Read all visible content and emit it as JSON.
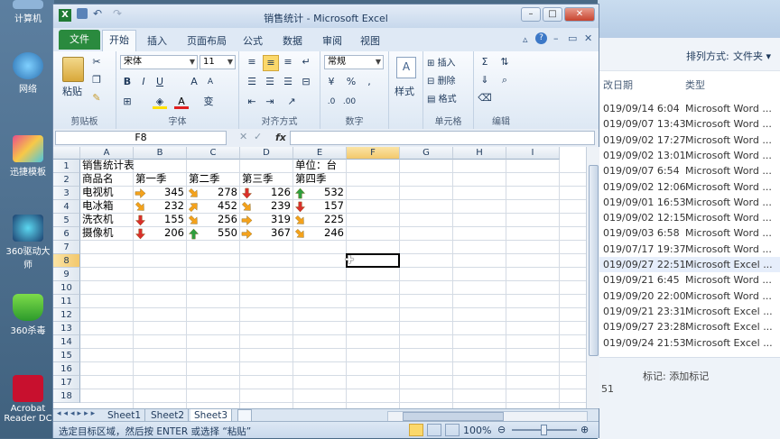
{
  "desktop": {
    "icons": [
      {
        "label": "计算机"
      },
      {
        "label": "网络"
      },
      {
        "label": "迅捷模板"
      },
      {
        "label": "360驱动大师"
      },
      {
        "label": "360杀毒"
      },
      {
        "label": "Acrobat Reader DC"
      }
    ]
  },
  "explorer": {
    "sort_label": "排列方式:",
    "sort_value": "文件夹 ▾",
    "col_date": "改日期",
    "col_type": "类型",
    "rows": [
      {
        "date": "019/09/14 6:04",
        "type": "Microsoft Word ..."
      },
      {
        "date": "019/09/07 13:43",
        "type": "Microsoft Word ..."
      },
      {
        "date": "019/09/02 17:27",
        "type": "Microsoft Word ..."
      },
      {
        "date": "019/09/02 13:01",
        "type": "Microsoft Word ..."
      },
      {
        "date": "019/09/07 6:54",
        "type": "Microsoft Word ..."
      },
      {
        "date": "019/09/02 12:06",
        "type": "Microsoft Word ..."
      },
      {
        "date": "019/09/01 16:53",
        "type": "Microsoft Word ..."
      },
      {
        "date": "019/09/02 12:15",
        "type": "Microsoft Word ..."
      },
      {
        "date": "019/09/03 6:58",
        "type": "Microsoft Word ..."
      },
      {
        "date": "019/07/17 19:37",
        "type": "Microsoft Word ..."
      },
      {
        "date": "019/09/27 22:51",
        "type": "Microsoft Excel ..."
      },
      {
        "date": "019/09/21 6:45",
        "type": "Microsoft Word ..."
      },
      {
        "date": "019/09/20 22:00",
        "type": "Microsoft Word ..."
      },
      {
        "date": "019/09/21 23:31",
        "type": "Microsoft Excel ..."
      },
      {
        "date": "019/09/27 23:28",
        "type": "Microsoft Excel ..."
      },
      {
        "date": "019/09/24 21:53",
        "type": "Microsoft Excel ..."
      }
    ],
    "tag_label": "标记: 添加标记",
    "count": "51"
  },
  "excel": {
    "title": "销售统计 - Microsoft Excel",
    "tabs": [
      "文件",
      "开始",
      "插入",
      "页面布局",
      "公式",
      "数据",
      "审阅",
      "视图"
    ],
    "groups": {
      "clipboard": "剪贴板",
      "font": "字体",
      "alignment": "对齐方式",
      "number": "数字",
      "cells": "单元格",
      "editing": "编辑"
    },
    "paste_label": "粘贴",
    "font_name": "宋体",
    "font_size": "11",
    "number_format": "常规",
    "style_label": "样式",
    "insert_label": "插入",
    "delete_label": "删除",
    "format_label": "格式",
    "name_box": "F8",
    "fx": "fx",
    "columns": [
      "A",
      "B",
      "C",
      "D",
      "E",
      "F",
      "G",
      "H",
      "I"
    ],
    "rows": [
      "1",
      "2",
      "3",
      "4",
      "5",
      "6",
      "7",
      "8",
      "9",
      "10",
      "11",
      "12",
      "13",
      "14",
      "15",
      "16",
      "17",
      "18"
    ],
    "sheet": {
      "title": "销售统计表",
      "unit": "单位：台",
      "header": [
        "商品名",
        "第一季",
        "第二季",
        "第三季",
        "第四季"
      ],
      "data": [
        {
          "name": "电视机",
          "values": [
            345,
            278,
            126,
            532
          ],
          "arrows": [
            "right",
            "down-right",
            "down",
            "up"
          ]
        },
        {
          "name": "电冰箱",
          "values": [
            232,
            452,
            239,
            157
          ],
          "arrows": [
            "down-right",
            "up-right",
            "down-right",
            "down"
          ]
        },
        {
          "name": "洗衣机",
          "values": [
            155,
            256,
            319,
            225
          ],
          "arrows": [
            "down",
            "down-right",
            "right",
            "down-right"
          ]
        },
        {
          "name": "摄像机",
          "values": [
            206,
            550,
            367,
            246
          ],
          "arrows": [
            "down",
            "up",
            "right",
            "down-right"
          ]
        }
      ]
    },
    "sheet_tabs": [
      "Sheet1",
      "Sheet2",
      "Sheet3"
    ],
    "active_sheet": "Sheet3",
    "status_text": "选定目标区域，然后按 ENTER 或选择 “粘贴”",
    "zoom": "100%",
    "colors": {
      "up": "#2e9e3e",
      "down": "#d9302b",
      "right": "#f4a21c",
      "diag": "#f4a21c",
      "file_tab": "#2a8a3e"
    }
  }
}
